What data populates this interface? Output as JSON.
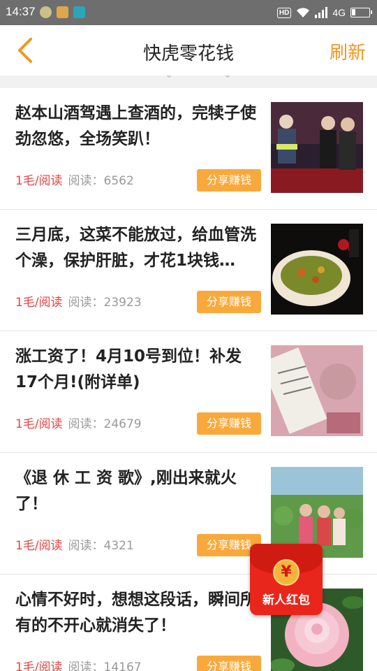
{
  "status_bar": {
    "time": "14:37",
    "hd": "HD",
    "network": "4G",
    "battery_level": 0.2
  },
  "header": {
    "back_icon": "chevron-left-icon",
    "title": "快虎零花钱",
    "refresh_label": "刷新"
  },
  "feed": {
    "items": [
      {
        "title": "赵本山酒驾遇上查酒的，完犊子使劲忽悠，全场笑趴！",
        "rate": "1毛/阅读",
        "reads": "阅读：6562",
        "share_label": "分享赚钱"
      },
      {
        "title": "三月底，这菜不能放过，给血管洗个澡，保护肝脏，才花1块钱…",
        "rate": "1毛/阅读",
        "reads": "阅读：23923",
        "share_label": "分享赚钱"
      },
      {
        "title": "涨工资了！4月10号到位！补发17个月!(附详单)",
        "rate": "1毛/阅读",
        "reads": "阅读：24679",
        "share_label": "分享赚钱"
      },
      {
        "title": "《退 休 工 资 歌》,刚出来就火了！",
        "rate": "1毛/阅读",
        "reads": "阅读：4321",
        "share_label": "分享赚钱"
      },
      {
        "title": "心情不好时，想想这段话，瞬间所有的不开心就消失了！",
        "rate": "1毛/阅读",
        "reads": "阅读：14167",
        "share_label": "分享赚钱"
      }
    ]
  },
  "red_packet": {
    "coin_symbol": "¥",
    "label": "新人红包"
  },
  "colors": {
    "accent": "#f7941d",
    "share_button": "#f9a93c",
    "rate_text": "#e64340",
    "status_bar": "#6e6e6e",
    "red_packet": "#e8261c"
  }
}
